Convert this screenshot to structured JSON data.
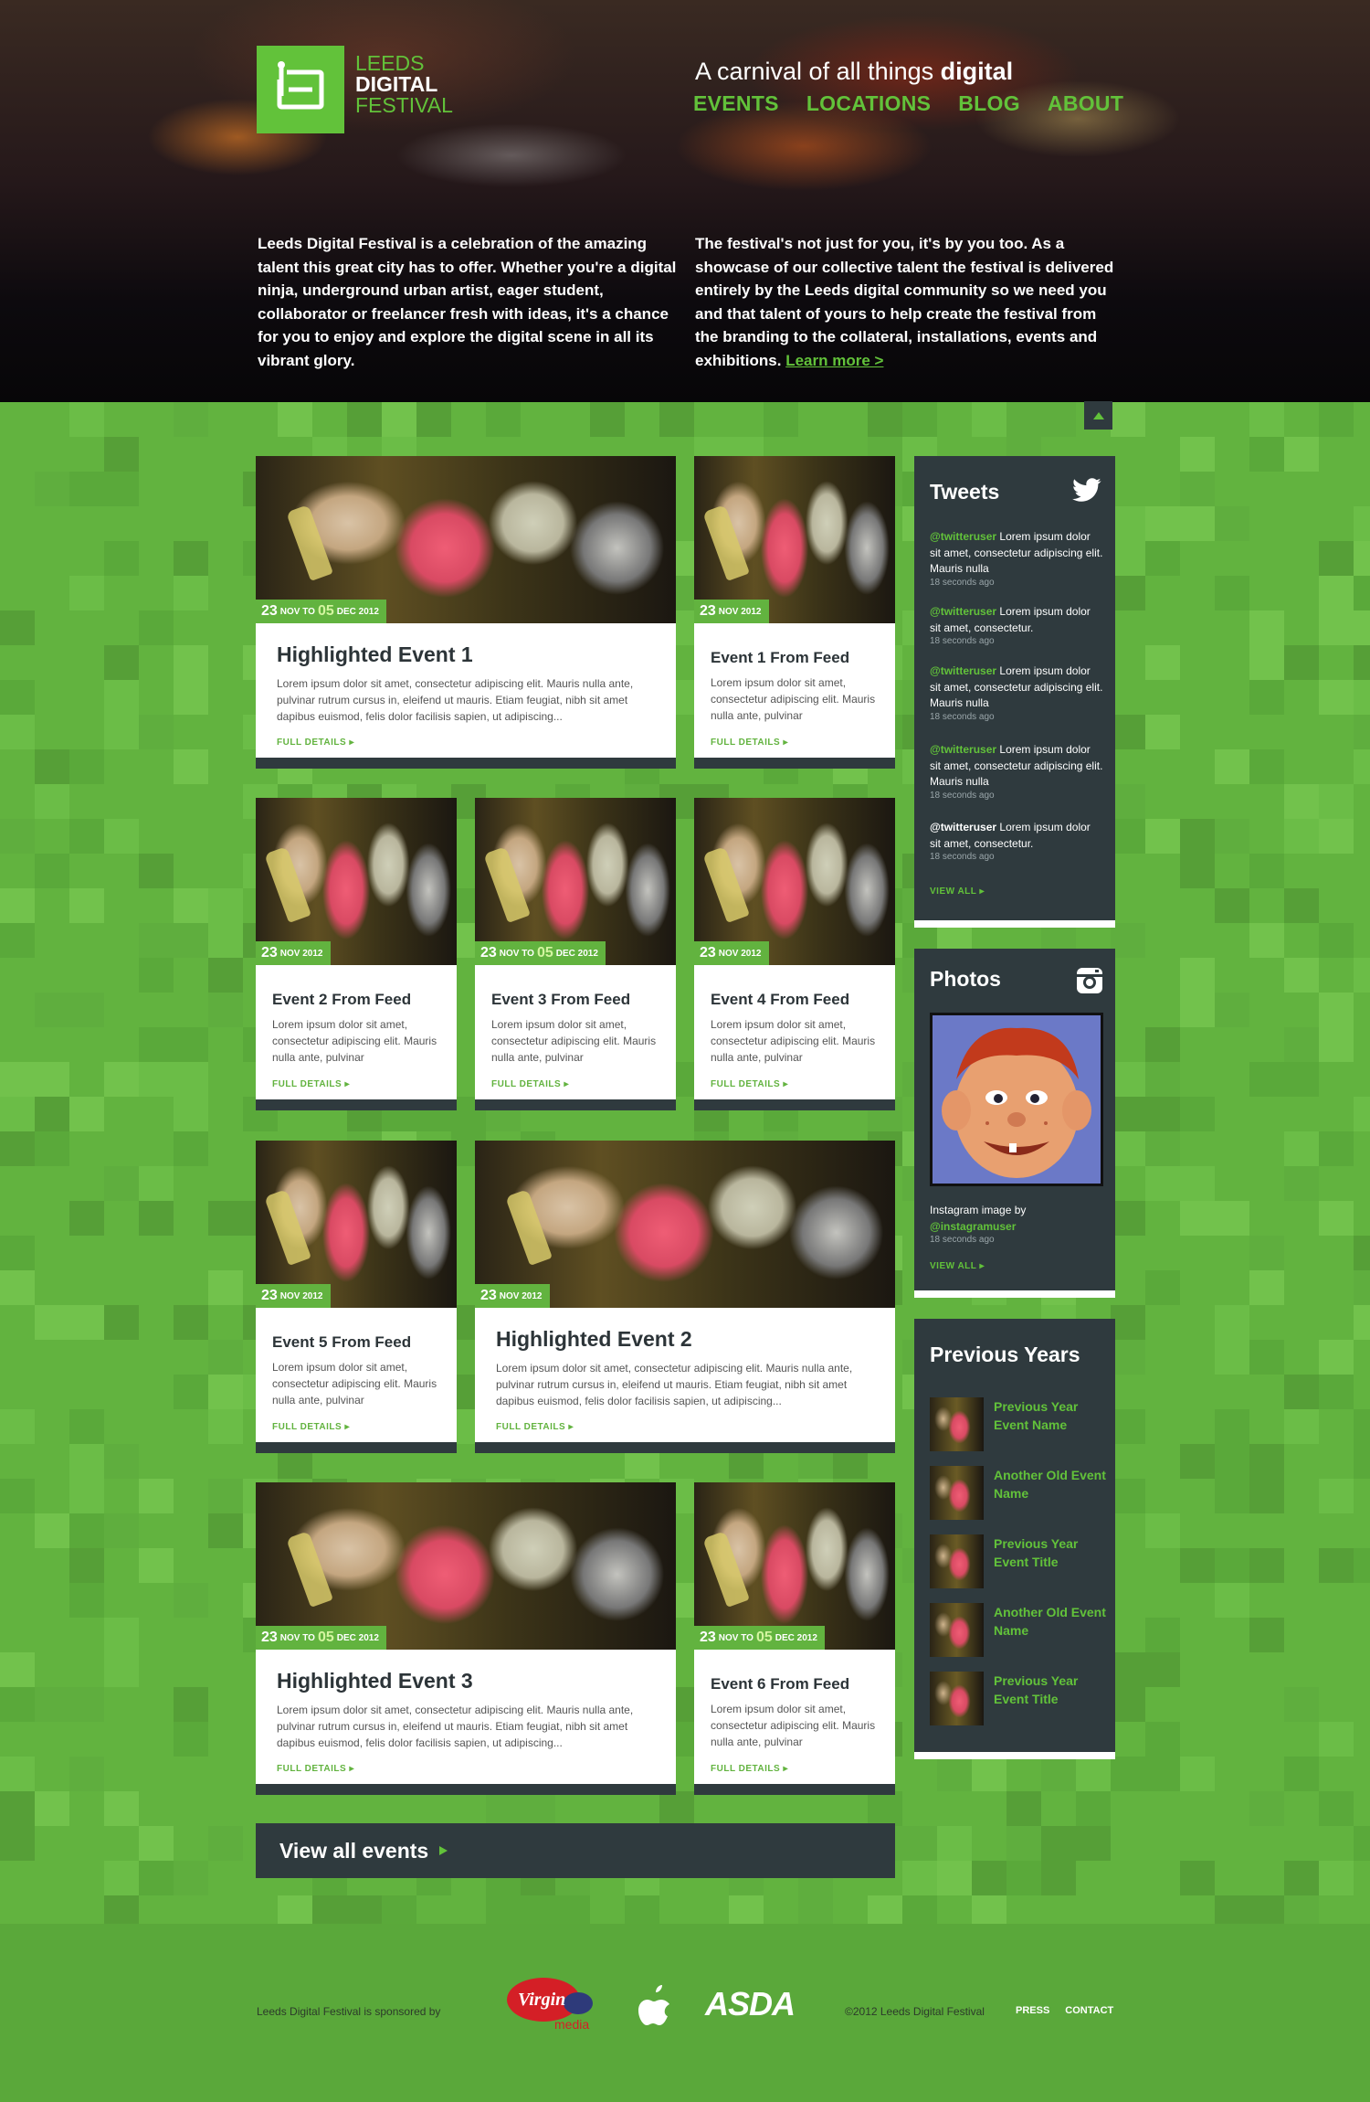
{
  "brand": {
    "logo_line1": "LEEDS",
    "logo_line2": "DIGITAL",
    "logo_line3": "FESTIVAL",
    "tagline_prefix": "A carnival of all things",
    "tagline_bold": "digital",
    "accent": "#62c23a",
    "dark": "#2f3a3e"
  },
  "nav": [
    "EVENTS",
    "LOCATIONS",
    "BLOG",
    "ABOUT"
  ],
  "intro": {
    "left": "Leeds Digital Festival is a celebration of the amazing talent this great city has to offer. Whether you're a digital ninja, underground urban artist, eager student, collaborator or freelancer fresh with ideas, it's a chance for you to enjoy and explore the digital scene in all its vibrant glory.",
    "right": "The festival's not just for you, it's by you too. As a showcase of our collective talent the festival is delivered entirely by the Leeds digital community so we need you and that talent of yours to help create the festival from the branding to the collateral, installations, events and exhibitions.",
    "learn_more": "Learn more >"
  },
  "events": [
    {
      "title": "Highlighted Event 1",
      "d1": "23",
      "m1": "NOV TO",
      "d2": "05",
      "m2": "DEC 2012",
      "text": "Lorem ipsum dolor sit amet, consectetur adipiscing elit. Mauris nulla ante, pulvinar rutrum cursus in, eleifend ut mauris. Etiam feugiat, nibh sit amet dapibus euismod, felis dolor facilisis sapien, ut adipiscing...",
      "more": "FULL DETAILS"
    },
    {
      "title": "Event 1 From Feed",
      "d1": "23",
      "m1": "NOV 2012",
      "text": "Lorem ipsum dolor sit amet, consectetur adipiscing elit. Mauris nulla ante, pulvinar",
      "more": "FULL DETAILS"
    },
    {
      "title": "Event 2 From Feed",
      "d1": "23",
      "m1": "NOV 2012",
      "text": "Lorem ipsum dolor sit amet, consectetur adipiscing elit. Mauris nulla ante, pulvinar",
      "more": "FULL DETAILS"
    },
    {
      "title": "Event 3 From Feed",
      "d1": "23",
      "m1": "NOV TO",
      "d2": "05",
      "m2": "DEC 2012",
      "text": "Lorem ipsum dolor sit amet, consectetur adipiscing elit. Mauris nulla ante, pulvinar",
      "more": "FULL DETAILS"
    },
    {
      "title": "Event 4 From Feed",
      "d1": "23",
      "m1": "NOV 2012",
      "text": "Lorem ipsum dolor sit amet, consectetur adipiscing elit. Mauris nulla ante, pulvinar",
      "more": "FULL DETAILS"
    },
    {
      "title": "Event 5 From Feed",
      "d1": "23",
      "m1": "NOV 2012",
      "text": "Lorem ipsum dolor sit amet, consectetur adipiscing elit. Mauris nulla ante, pulvinar",
      "more": "FULL DETAILS"
    },
    {
      "title": "Highlighted Event 2",
      "d1": "23",
      "m1": "NOV 2012",
      "text": "Lorem ipsum dolor sit amet, consectetur adipiscing elit. Mauris nulla ante, pulvinar rutrum cursus in, eleifend ut mauris. Etiam feugiat, nibh sit amet dapibus euismod, felis dolor facilisis sapien, ut adipiscing...",
      "more": "FULL DETAILS"
    },
    {
      "title": "Highlighted Event 3",
      "d1": "23",
      "m1": "NOV TO",
      "d2": "05",
      "m2": "DEC 2012",
      "text": "Lorem ipsum dolor sit amet, consectetur adipiscing elit. Mauris nulla ante, pulvinar rutrum cursus in, eleifend ut mauris. Etiam feugiat, nibh sit amet dapibus euismod, felis dolor facilisis sapien, ut adipiscing...",
      "more": "FULL DETAILS"
    },
    {
      "title": "Event 6 From Feed",
      "d1": "23",
      "m1": "NOV TO",
      "d2": "05",
      "m2": "DEC 2012",
      "text": "Lorem ipsum dolor sit amet, consectetur adipiscing elit. Mauris nulla ante, pulvinar",
      "more": "FULL DETAILS"
    }
  ],
  "view_all_events": "View all events",
  "tweets": {
    "title": "Tweets",
    "items": [
      {
        "user": "@twitteruser",
        "text": "Lorem ipsum dolor sit amet, consectetur adipiscing elit. Mauris nulla",
        "ago": "18 seconds ago"
      },
      {
        "user": "@twitteruser",
        "text": "Lorem ipsum dolor sit amet, consectetur.",
        "ago": "18 seconds ago"
      },
      {
        "user": "@twitteruser",
        "text": "Lorem ipsum dolor sit amet, consectetur adipiscing elit. Mauris nulla",
        "ago": "18 seconds ago"
      },
      {
        "user": "@twitteruser",
        "text": "Lorem ipsum dolor sit amet, consectetur adipiscing elit. Mauris nulla",
        "ago": "18 seconds ago"
      },
      {
        "user": "@twitteruser",
        "text": "Lorem ipsum dolor sit amet, consectetur.",
        "ago": "18 seconds ago"
      }
    ],
    "view_all": "VIEW ALL"
  },
  "photos": {
    "title": "Photos",
    "caption": "Instagram image by",
    "user": "@instagramuser",
    "ago": "18 seconds ago",
    "view_all": "VIEW ALL"
  },
  "previous_years": {
    "title": "Previous Years",
    "items": [
      "Previous Year Event Name",
      "Another Old Event Name",
      "Previous Year Event Title",
      "Another Old Event Name",
      "Previous Year Event Title"
    ]
  },
  "footer": {
    "sponsor_text": "Leeds Digital Festival is sponsored by",
    "sponsor_virgin": "Virgin",
    "sponsor_virgin_sub": "media",
    "sponsor_asda": "ASDA",
    "copyright": "©2012 Leeds Digital Festival",
    "links": [
      "PRESS",
      "CONTACT"
    ]
  }
}
